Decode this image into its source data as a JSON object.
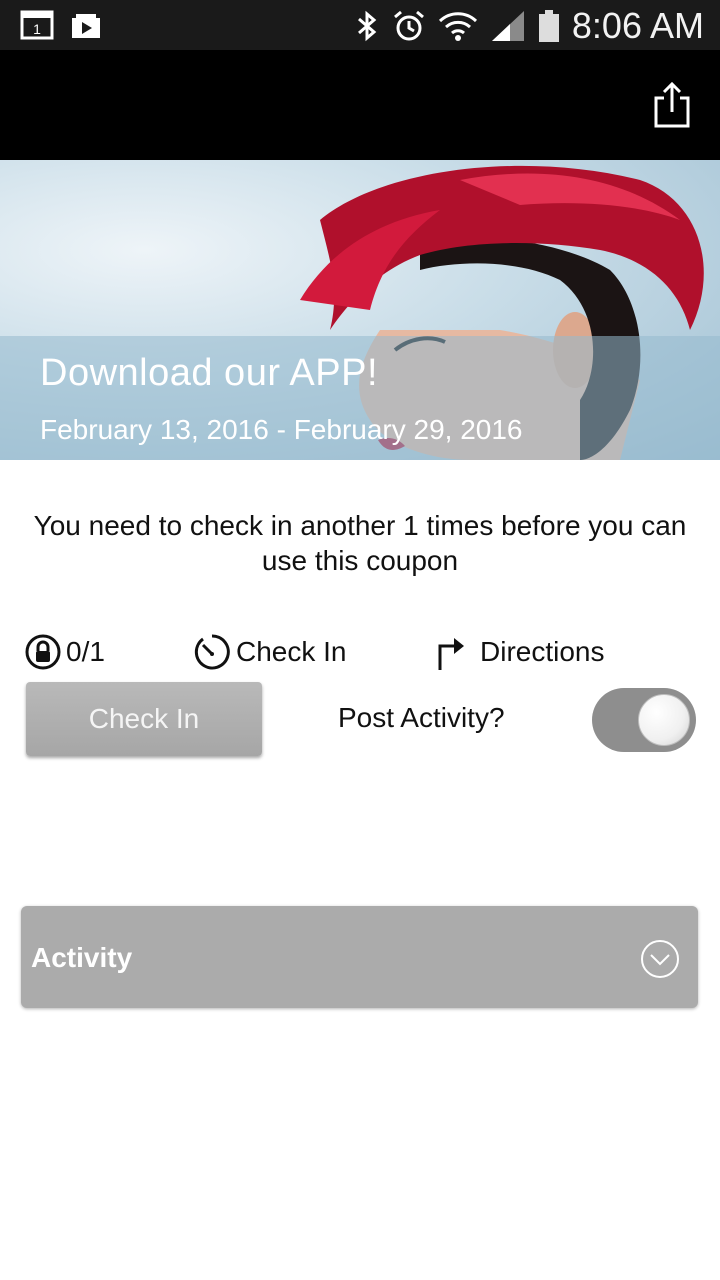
{
  "status_bar": {
    "time": "8:06 AM",
    "icons": [
      "calendar-icon",
      "media-icon",
      "bluetooth-icon",
      "alarm-icon",
      "wifi-icon",
      "signal-icon",
      "battery-icon"
    ]
  },
  "toolbar": {
    "share_icon": "share-icon"
  },
  "promo": {
    "title": "Download  our APP!",
    "date_range": "February 13, 2016 - February 29, 2016"
  },
  "notice": {
    "text": "You need to check in another 1 times before you can use this coupon"
  },
  "stats": {
    "progress": "0/1",
    "checkin_label": "Check In",
    "directions_label": "Directions"
  },
  "actions": {
    "checkin_button": "Check In",
    "post_activity_label": "Post Activity?",
    "post_activity_on": false
  },
  "activity": {
    "label": "Activity"
  },
  "colors": {
    "toolbar": "#000000",
    "button_gray": "#ababab",
    "toggle_track": "#8e8e8e"
  }
}
